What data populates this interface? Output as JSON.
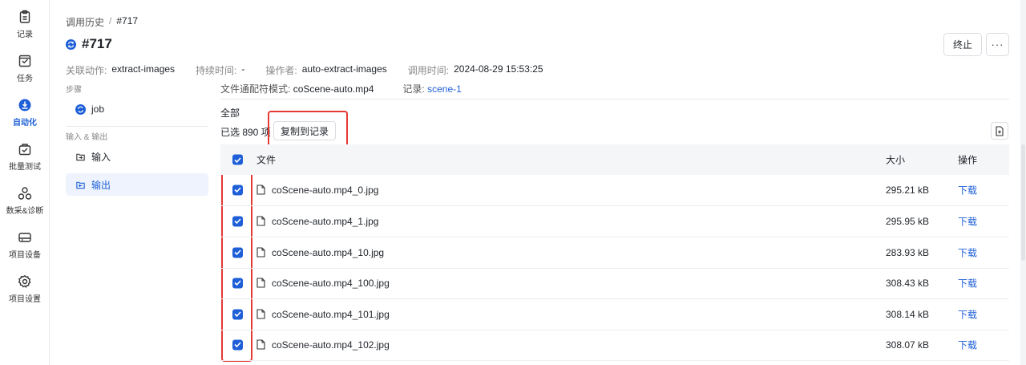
{
  "nav": {
    "items": [
      {
        "label": "记录",
        "icon": "clipboard-icon"
      },
      {
        "label": "任务",
        "icon": "task-icon"
      },
      {
        "label": "自动化",
        "icon": "automation-icon",
        "active": true
      },
      {
        "label": "批量测试",
        "icon": "batch-test-icon"
      },
      {
        "label": "数采&诊断",
        "icon": "diagnosis-icon"
      },
      {
        "label": "项目设备",
        "icon": "device-icon"
      },
      {
        "label": "项目设置",
        "icon": "gear-icon"
      }
    ]
  },
  "breadcrumb": {
    "parent": "调用历史",
    "sep": "/",
    "current": "#717"
  },
  "header": {
    "title": "#717",
    "stop_label": "终止",
    "more_label": "···"
  },
  "meta": {
    "action_k": "关联动作:",
    "action_v": "extract-images",
    "duration_k": "持续时间:",
    "duration_v": "-",
    "operator_k": "操作者:",
    "operator_v": "auto-extract-images",
    "time_k": "调用时间:",
    "time_v": "2024-08-29 15:53:25"
  },
  "steps": {
    "heading": "步骤",
    "job_label": "job",
    "io_heading": "输入 & 输出",
    "input_label": "输入",
    "output_label": "输出"
  },
  "filter": {
    "pattern_k": "文件通配符模式:",
    "pattern_v": "coScene-auto.mp4",
    "record_k": "记录:",
    "record_v": "scene-1"
  },
  "files": {
    "all_label": "全部",
    "selected_text": "已选 890 项",
    "copy_button": "复制到记录",
    "headers": {
      "file": "文件",
      "size": "大小",
      "action": "操作"
    },
    "rows": [
      {
        "name": "coScene-auto.mp4_0.jpg",
        "size": "295.21 kB",
        "action": "下载"
      },
      {
        "name": "coScene-auto.mp4_1.jpg",
        "size": "295.95 kB",
        "action": "下载"
      },
      {
        "name": "coScene-auto.mp4_10.jpg",
        "size": "283.93 kB",
        "action": "下载"
      },
      {
        "name": "coScene-auto.mp4_100.jpg",
        "size": "308.43 kB",
        "action": "下载"
      },
      {
        "name": "coScene-auto.mp4_101.jpg",
        "size": "308.14 kB",
        "action": "下载"
      },
      {
        "name": "coScene-auto.mp4_102.jpg",
        "size": "308.07 kB",
        "action": "下载"
      }
    ]
  },
  "colors": {
    "accent": "#1e5fd8",
    "highlight": "#e53935"
  }
}
